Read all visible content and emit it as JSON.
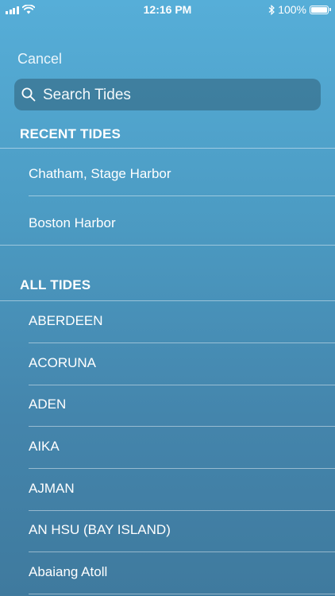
{
  "status": {
    "time": "12:16 PM",
    "battery_percent": "100%",
    "icons": [
      "signal-icon",
      "wifi-icon",
      "bluetooth-icon",
      "battery-icon"
    ]
  },
  "nav": {
    "cancel_label": "Cancel"
  },
  "search": {
    "placeholder": "Search Tides",
    "value": ""
  },
  "recent": {
    "header": "RECENT TIDES",
    "items": [
      "Chatham, Stage Harbor",
      "Boston Harbor"
    ]
  },
  "all": {
    "header": "ALL TIDES",
    "items": [
      "ABERDEEN",
      "ACORUNA",
      "ADEN",
      "AIKA",
      "AJMAN",
      "AN HSU (BAY ISLAND)",
      "Abaiang Atoll"
    ]
  }
}
